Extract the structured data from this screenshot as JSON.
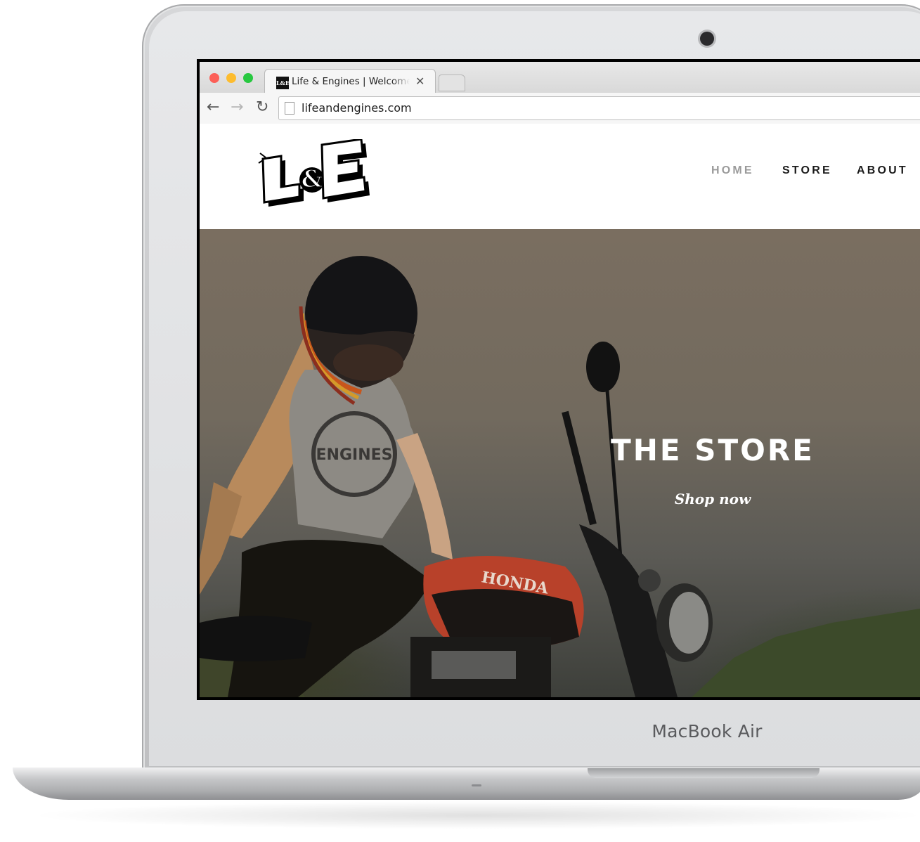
{
  "device": {
    "brand_label": "MacBook Air"
  },
  "browser": {
    "tab": {
      "title": "Life & Engines | Welcome",
      "favicon_text": "L&E",
      "close_glyph": "✕"
    },
    "toolbar": {
      "back_glyph": "←",
      "forward_glyph": "→",
      "reload_glyph": "↻"
    },
    "address": {
      "url": "lifeandengines.com"
    }
  },
  "site": {
    "logo_alt": "L&E",
    "nav": [
      {
        "label": "HOME",
        "active": true
      },
      {
        "label": "STORE",
        "active": false
      },
      {
        "label": "ABOUT",
        "active": false
      }
    ],
    "hero": {
      "title": "THE STORE",
      "cta": "Shop now",
      "tank_text": "HONDA",
      "shirt_text": "ENGINES"
    }
  },
  "colors": {
    "nav_active": "#9a9a9a",
    "nav_default": "#1a1a1a",
    "traffic_red": "#fc5f57",
    "traffic_yellow": "#fdbc2e",
    "traffic_green": "#28c840"
  }
}
